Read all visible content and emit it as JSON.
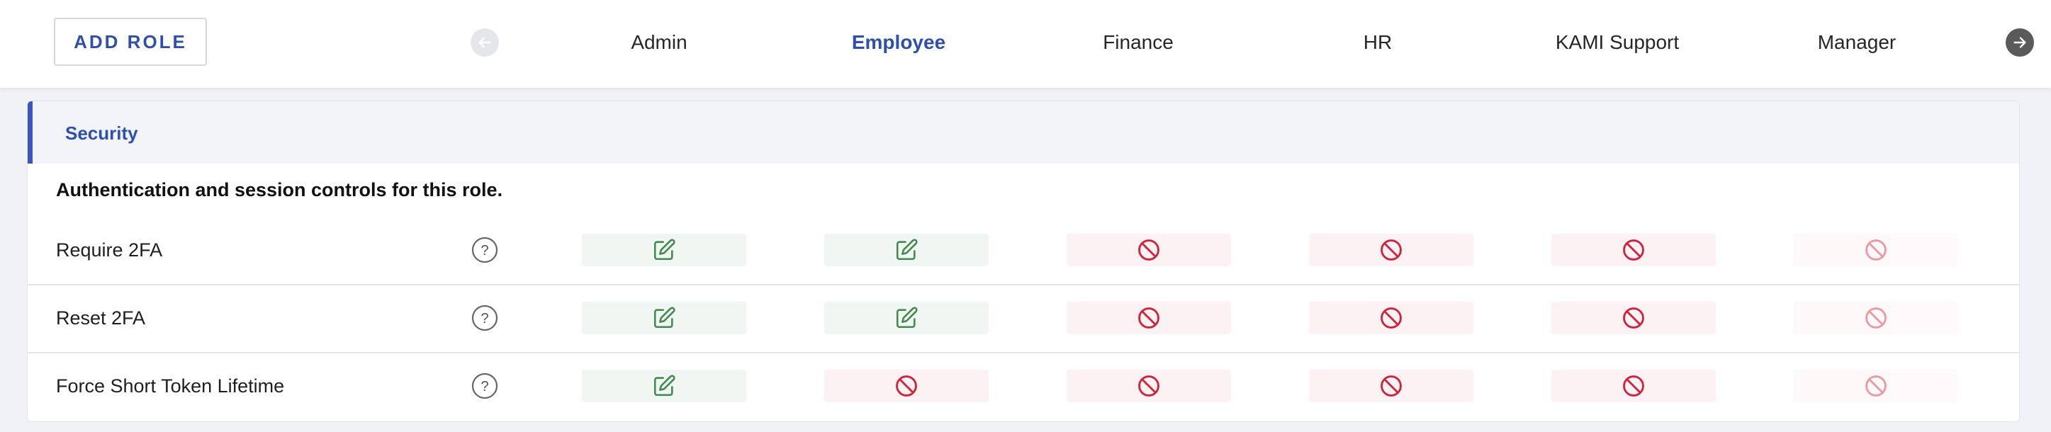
{
  "toolbar": {
    "add_role_label": "ADD ROLE",
    "prev_icon": "arrow-left-icon",
    "next_icon": "arrow-right-icon"
  },
  "roles": [
    {
      "label": "Admin",
      "active": false
    },
    {
      "label": "Employee",
      "active": true
    },
    {
      "label": "Finance",
      "active": false
    },
    {
      "label": "HR",
      "active": false
    },
    {
      "label": "KAMI Support",
      "active": false
    },
    {
      "label": "Manager",
      "active": false
    }
  ],
  "section": {
    "title": "Security",
    "description": "Authentication and session controls for this role.",
    "rows": [
      {
        "label": "Require 2FA",
        "help_icon": "help-icon",
        "permissions": [
          "edit",
          "edit",
          "deny",
          "deny",
          "deny",
          "deny"
        ]
      },
      {
        "label": "Reset 2FA",
        "help_icon": "help-icon",
        "permissions": [
          "edit",
          "edit",
          "deny",
          "deny",
          "deny",
          "deny"
        ]
      },
      {
        "label": "Force Short Token Lifetime",
        "help_icon": "help-icon",
        "permissions": [
          "edit",
          "deny",
          "deny",
          "deny",
          "deny",
          "deny"
        ]
      }
    ]
  },
  "colors": {
    "accent": "#2f4fae",
    "edit_icon": "#3f8a4f",
    "deny_icon": "#d0223a",
    "edit_bg": "#f1f6f3",
    "deny_bg": "#fdf2f3"
  }
}
